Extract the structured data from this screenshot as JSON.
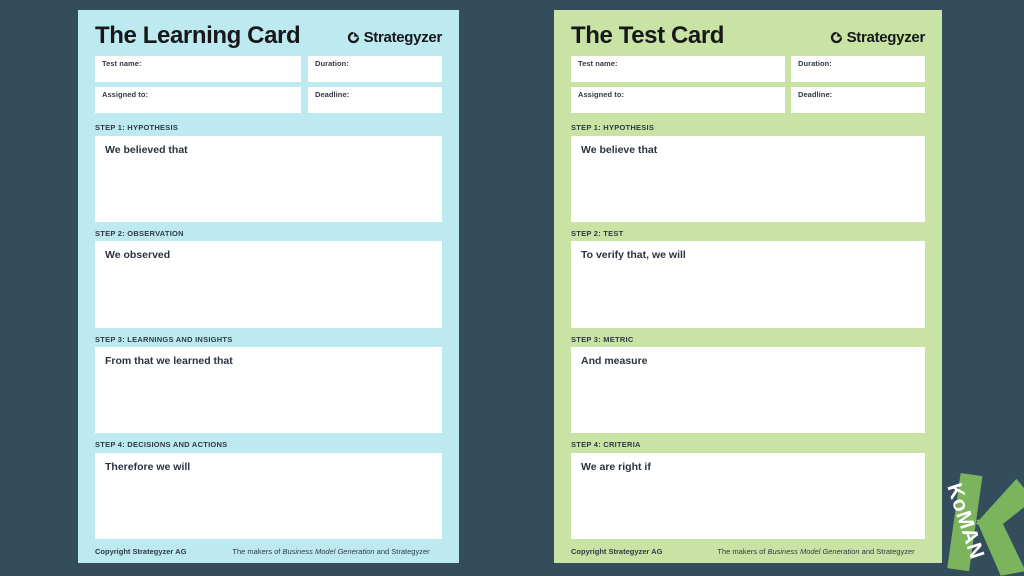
{
  "canvas": {
    "background_color": "#344d5c"
  },
  "brand": {
    "name": "Strategyzer",
    "mark_icon": "strategyzer-circle-icon"
  },
  "cards": [
    {
      "id": "learning-card",
      "title": "The Learning Card",
      "background_color": "#bdeaf0",
      "meta_fields": [
        {
          "label": "Test name:",
          "value": ""
        },
        {
          "label": "Duration:",
          "value": ""
        },
        {
          "label": "Assigned to:",
          "value": ""
        },
        {
          "label": "Deadline:",
          "value": ""
        }
      ],
      "steps": [
        {
          "label": "STEP 1: HYPOTHESIS",
          "prompt": "We believed that",
          "value": ""
        },
        {
          "label": "STEP 2: OBSERVATION",
          "prompt": "We observed",
          "value": ""
        },
        {
          "label": "STEP 3: LEARNINGS AND INSIGHTS",
          "prompt": "From that we learned that",
          "value": ""
        },
        {
          "label": "STEP 4: DECISIONS AND ACTIONS",
          "prompt": "Therefore we will",
          "value": ""
        }
      ],
      "footer": {
        "copyright": "Copyright Strategyzer AG",
        "makers_prefix": "The makers of ",
        "makers_italic": "Business Model Generation",
        "makers_suffix": " and Strategyzer"
      }
    },
    {
      "id": "test-card",
      "title": "The Test Card",
      "background_color": "#c9e3a4",
      "meta_fields": [
        {
          "label": "Test name:",
          "value": ""
        },
        {
          "label": "Duration:",
          "value": ""
        },
        {
          "label": "Assigned to:",
          "value": ""
        },
        {
          "label": "Deadline:",
          "value": ""
        }
      ],
      "steps": [
        {
          "label": "STEP 1: HYPOTHESIS",
          "prompt": "We believe that",
          "value": ""
        },
        {
          "label": "STEP 2: TEST",
          "prompt": "To verify that, we will",
          "value": ""
        },
        {
          "label": "STEP 3: METRIC",
          "prompt": "And measure",
          "value": ""
        },
        {
          "label": "STEP 4: CRITERIA",
          "prompt": "We are right if",
          "value": ""
        }
      ],
      "footer": {
        "copyright": "Copyright Strategyzer AG",
        "makers_prefix": "The makers of ",
        "makers_italic": "Business Model Generation",
        "makers_suffix": " and Strategyzer"
      }
    }
  ],
  "watermark": {
    "letter": "K",
    "text": "KoMAN",
    "color": "#7cb45e"
  }
}
